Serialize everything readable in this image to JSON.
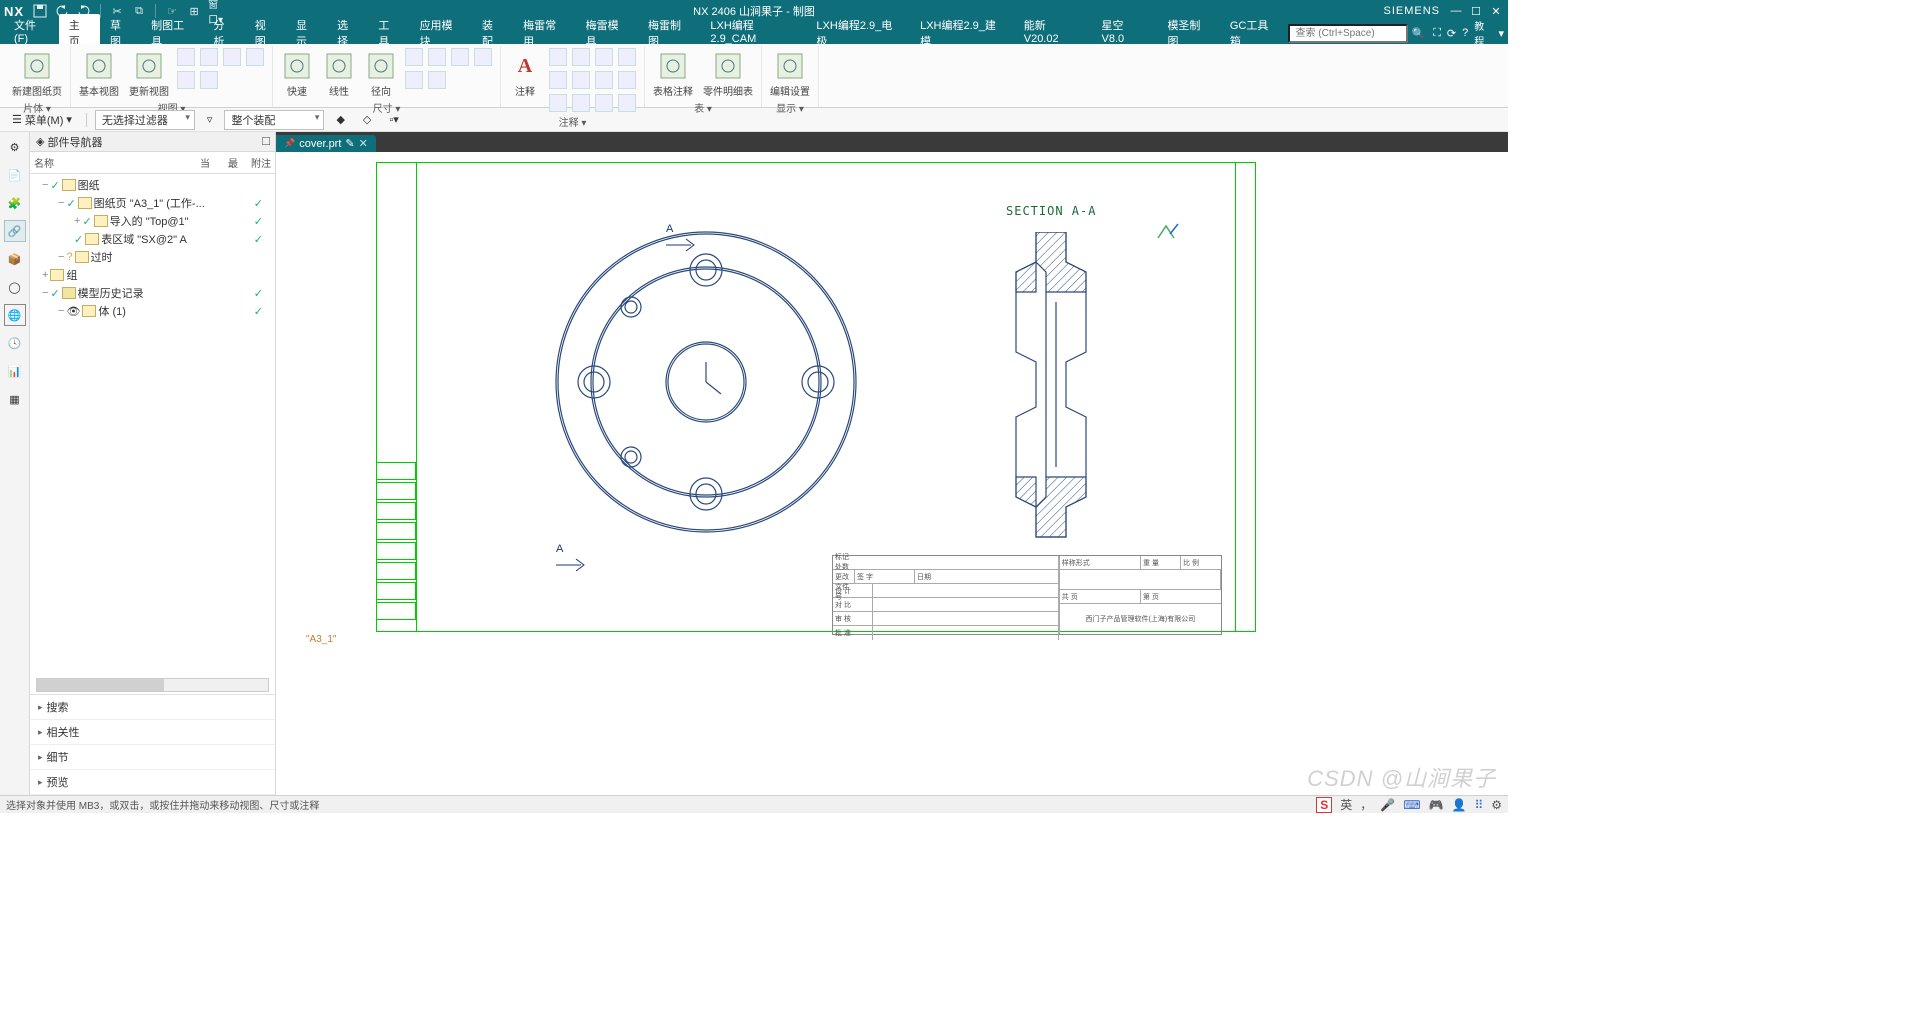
{
  "app": {
    "logo": "NX",
    "title": "NX 2406 山涧果子 - 制图",
    "brand": "SIEMENS"
  },
  "menus": {
    "items": [
      "文件(F)",
      "主页",
      "草图",
      "制图工具",
      "分析",
      "视图",
      "显示",
      "选择",
      "工具",
      "应用模块",
      "装配",
      "梅雷常用",
      "梅雷模具",
      "梅雷制图",
      "LXH编程2.9_CAM",
      "LXH编程2.9_电极",
      "LXH编程2.9_建模",
      "能新 V20.02",
      "星空 V8.0",
      "模圣制图",
      "GC工具箱"
    ],
    "active_index": 1,
    "search_placeholder": "查索 (Ctrl+Space)",
    "help": "教程"
  },
  "ribbon": {
    "groups": [
      {
        "label": "片体",
        "big": [
          {
            "n": "新建图纸页",
            "i": "new-sheet-icon"
          }
        ]
      },
      {
        "label": "视图",
        "big": [
          {
            "n": "基本视图",
            "i": "base-view-icon"
          },
          {
            "n": "更新视图",
            "i": "update-view-icon"
          }
        ],
        "small": 6
      },
      {
        "label": "尺寸",
        "big": [
          {
            "n": "快速",
            "i": "quick-dim-icon"
          },
          {
            "n": "线性",
            "i": "linear-dim-icon"
          },
          {
            "n": "径向",
            "i": "radial-dim-icon"
          }
        ],
        "small": 6
      },
      {
        "label": "注释",
        "big": [
          {
            "n": "注释",
            "i": "note-icon"
          }
        ],
        "small": 12,
        "text_color": "#c0392b"
      },
      {
        "label": "表",
        "big": [
          {
            "n": "表格注释",
            "i": "table-note-icon"
          },
          {
            "n": "零件明细表",
            "i": "parts-list-icon"
          }
        ]
      },
      {
        "label": "显示",
        "big": [
          {
            "n": "编辑设置",
            "i": "edit-settings-icon"
          }
        ]
      }
    ]
  },
  "filterbar": {
    "menu": "菜单(M)",
    "filter1": "无选择过滤器",
    "filter2": "整个装配"
  },
  "navigator": {
    "title": "部件导航器",
    "columns": [
      "名称",
      "当",
      "最",
      "附注"
    ],
    "tree": [
      {
        "d": 0,
        "t": "图纸",
        "chk": "✓",
        "st": ""
      },
      {
        "d": 1,
        "t": "图纸页 \"A3_1\" (工作-...",
        "chk": "✓",
        "st": "✓"
      },
      {
        "d": 2,
        "t": "导入的 \"Top@1\"",
        "chk": "✓",
        "st": "✓",
        "pre": "+"
      },
      {
        "d": 2,
        "t": "表区域 \"SX@2\" A",
        "chk": "✓",
        "st": "✓"
      },
      {
        "d": 1,
        "t": "过时",
        "chk": "?",
        "q": true
      },
      {
        "d": 0,
        "t": "组",
        "pre": "+"
      },
      {
        "d": 0,
        "t": "模型历史记录",
        "chk": "✓",
        "m": true,
        "st": "✓"
      },
      {
        "d": 1,
        "t": "体 (1)",
        "eye": true,
        "st": "✓"
      }
    ],
    "accordion": [
      "搜索",
      "相关性",
      "细节",
      "预览"
    ]
  },
  "tab": {
    "name": "cover.prt"
  },
  "drawing": {
    "section_label": "SECTION A-A",
    "arrow_label": "A",
    "sheet_name": "\"A3_1\"",
    "titleblock": {
      "r1": [
        "样称形式",
        "重 量",
        "比 例"
      ],
      "r2": [
        "标记 处数 更改文件号",
        "签 字",
        "日期"
      ],
      "r3": [
        "设 计",
        "共  页",
        "第  页"
      ],
      "r4": [
        "对 比"
      ],
      "r5": [
        "审 核"
      ],
      "r6": [
        "批 准",
        "西门子产品管理软件(上海)有限公司"
      ]
    }
  },
  "statusbar": {
    "hint": "选择对象并使用 MB3，或双击，或按住并拖动来移动视图、尺寸或注释",
    "ime": "英"
  },
  "watermark": "CSDN @山涧果子"
}
